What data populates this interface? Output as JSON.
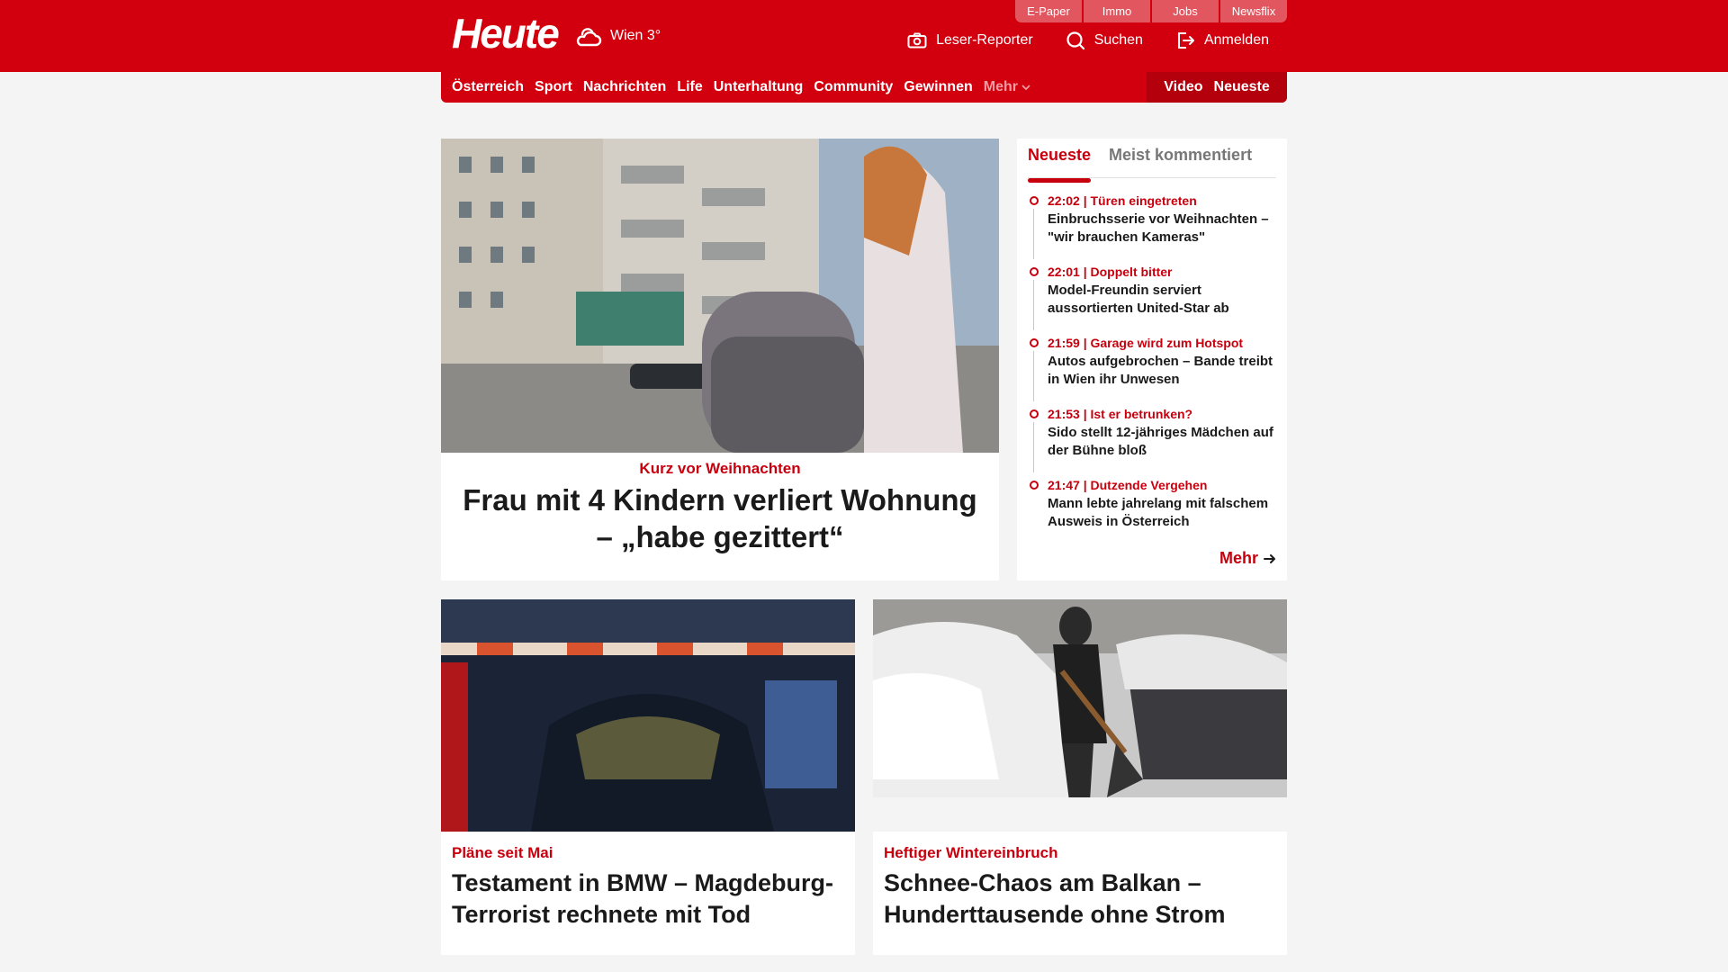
{
  "header": {
    "logo": "Heute",
    "weather": "Wien 3°",
    "utility_links": [
      "E-Paper",
      "Immo",
      "Jobs",
      "Newsflix"
    ],
    "actions": {
      "reporter": "Leser-Reporter",
      "search": "Suchen",
      "login": "Anmelden"
    }
  },
  "nav": {
    "items": [
      "Österreich",
      "Sport",
      "Nachrichten",
      "Life",
      "Unterhaltung",
      "Community",
      "Gewinnen"
    ],
    "more": "Mehr",
    "right": [
      "Video",
      "Neueste"
    ]
  },
  "hero": {
    "kicker": "Kurz vor Weihnachten",
    "title": "Frau mit 4 Kindern verliert Wohnung – „habe gezittert“"
  },
  "sidebar": {
    "tabs": [
      "Neueste",
      "Meist kommentiert"
    ],
    "items": [
      {
        "meta": "22:02 | Türen eingetreten",
        "title": "Einbruchsserie vor Weihnachten – \"wir brauchen Kameras\""
      },
      {
        "meta": "22:01 | Doppelt bitter",
        "title": "Model-Freundin serviert aussortierten United-Star ab"
      },
      {
        "meta": "21:59 | Garage wird zum Hotspot",
        "title": "Autos aufgebrochen – Bande treibt in Wien ihr Unwesen"
      },
      {
        "meta": "21:53 | Ist er betrunken?",
        "title": "Sido stellt 12-jähriges Mädchen auf der Bühne bloß"
      },
      {
        "meta": "21:47 | Dutzende Vergehen",
        "title": "Mann lebte jahrelang mit falschem Ausweis in Österreich"
      }
    ],
    "more": "Mehr"
  },
  "cards": [
    {
      "kicker": "Pläne seit Mai",
      "title": "Testament in BMW – Magdeburg-Terrorist rechnete mit Tod"
    },
    {
      "kicker": "Heftiger Wintereinbruch",
      "title": "Schnee-Chaos am Balkan – Hunderttausende ohne Strom"
    }
  ],
  "colors": {
    "brand": "#d2000f",
    "accent": "#c8000e"
  }
}
